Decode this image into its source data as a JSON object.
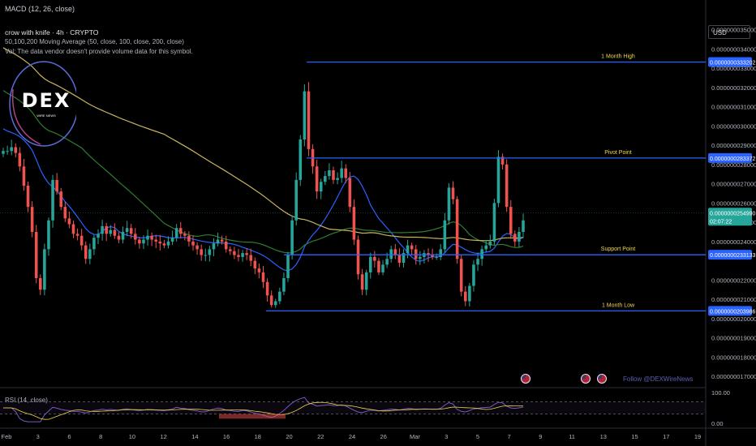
{
  "header": {
    "macd_label": "MACD (12, 26, close)",
    "symbol_line": "crow with knife · 4h · CRYPTO",
    "ma_line": "50,100,200 Moving Average (50, close, 100, close, 200, close)",
    "vol_line": "Vol: The data vendor doesn't provide volume data for this symbol."
  },
  "currency_button": "USD",
  "logo": {
    "text": "DEX",
    "subtext": "WIRE NEWS"
  },
  "follow_text": "Follow @DEXWireNews",
  "colors": {
    "bull": "#26a69a",
    "bear": "#ef5350",
    "level_line": "#2962ff",
    "ma50": "#2962ff",
    "ma100": "#2e7d32",
    "ma200": "#c9b45e",
    "rsi_line": "#7e57c2",
    "price_tag": "#26a69a",
    "logo_ring": "#5a6bd8"
  },
  "chart_data": [
    {
      "type": "candlestick",
      "title": "crow with knife · 4h · CRYPTO",
      "currency": "USD",
      "ylim": [
        1.65e-08,
        3.57e-08
      ],
      "y_ticks": [
        "0.0000000350000",
        "0.0000000340000",
        "0.0000000330000",
        "0.0000000320000",
        "0.0000000310000",
        "0.0000000300000",
        "0.0000000290000",
        "0.0000000280000",
        "0.0000000270000",
        "0.0000000260000",
        "0.0000000250000",
        "0.0000000240000",
        "0.0000000220000",
        "0.0000000210000",
        "0.0000000200000",
        "0.0000000190000",
        "0.0000000180000",
        "0.0000000170000"
      ],
      "x_ticks": [
        "Feb",
        "3",
        "6",
        "8",
        "10",
        "12",
        "14",
        "16",
        "18",
        "20",
        "22",
        "24",
        "26",
        "Mar",
        "3",
        "5",
        "7",
        "9",
        "11",
        "13",
        "15",
        "17",
        "19"
      ],
      "levels": [
        {
          "label": "1 Month High",
          "price": "0.0000000333202",
          "value": 3.33202e-08
        },
        {
          "label": "Pivot Point",
          "price": "0.0000000283372",
          "value": 2.83372e-08
        },
        {
          "label": "Support Point",
          "price": "0.0000000233133",
          "value": 2.33133e-08
        },
        {
          "label": "1 Month Low",
          "price": "0.0000000203986",
          "value": 2.03986e-08
        }
      ],
      "last_price": {
        "value": "0.0000000254990",
        "countdown": "02:07:22"
      },
      "moving_averages": [
        {
          "name": "MA 50",
          "color": "#2962ff"
        },
        {
          "name": "MA 100",
          "color": "#2e7d32"
        },
        {
          "name": "MA 200",
          "color": "#c9b45e"
        }
      ],
      "candles_close": [
        2.87e-08,
        2.87e-08,
        2.89e-08,
        2.86e-08,
        2.79e-08,
        2.69e-08,
        2.58e-08,
        2.45e-08,
        2.21e-08,
        2.15e-08,
        2.36e-08,
        2.51e-08,
        2.72e-08,
        2.66e-08,
        2.58e-08,
        2.52e-08,
        2.49e-08,
        2.44e-08,
        2.43e-08,
        2.38e-08,
        2.31e-08,
        2.36e-08,
        2.42e-08,
        2.44e-08,
        2.48e-08,
        2.44e-08,
        2.46e-08,
        2.43e-08,
        2.41e-08,
        2.45e-08,
        2.47e-08,
        2.44e-08,
        2.41e-08,
        2.39e-08,
        2.41e-08,
        2.43e-08,
        2.41e-08,
        2.4e-08,
        2.39e-08,
        2.38e-08,
        2.4e-08,
        2.42e-08,
        2.47e-08,
        2.44e-08,
        2.43e-08,
        2.4e-08,
        2.38e-08,
        2.36e-08,
        2.33e-08,
        2.33e-08,
        2.36e-08,
        2.39e-08,
        2.41e-08,
        2.4e-08,
        2.36e-08,
        2.35e-08,
        2.33e-08,
        2.32e-08,
        2.34e-08,
        2.33e-08,
        2.3e-08,
        2.26e-08,
        2.24e-08,
        2.19e-08,
        2.12e-08,
        2.07e-08,
        2.09e-08,
        2.14e-08,
        2.21e-08,
        2.33e-08,
        2.51e-08,
        2.72e-08,
        2.93e-08,
        3.18e-08,
        2.88e-08,
        2.79e-08,
        2.66e-08,
        2.71e-08,
        2.74e-08,
        2.77e-08,
        2.72e-08,
        2.73e-08,
        2.78e-08,
        2.73e-08,
        2.58e-08,
        2.41e-08,
        2.23e-08,
        2.15e-08,
        2.24e-08,
        2.32e-08,
        2.3e-08,
        2.24e-08,
        2.28e-08,
        2.31e-08,
        2.36e-08,
        2.33e-08,
        2.29e-08,
        2.34e-08,
        2.38e-08,
        2.36e-08,
        2.31e-08,
        2.32e-08,
        2.34e-08,
        2.33e-08,
        2.32e-08,
        2.32e-08,
        2.36e-08,
        2.51e-08,
        2.68e-08,
        2.62e-08,
        2.31e-08,
        2.14e-08,
        2.09e-08,
        2.17e-08,
        2.28e-08,
        2.31e-08,
        2.36e-08,
        2.38e-08,
        2.4e-08,
        2.6e-08,
        2.84e-08,
        2.8e-08,
        2.58e-08,
        2.44e-08,
        2.4e-08,
        2.45e-08,
        2.51e-08
      ]
    },
    {
      "type": "line",
      "title": "RSI (14, close)",
      "ylim": [
        0,
        100
      ],
      "y_ticks": [
        "100.00",
        "0.00"
      ],
      "bands": [
        30,
        70
      ]
    }
  ]
}
